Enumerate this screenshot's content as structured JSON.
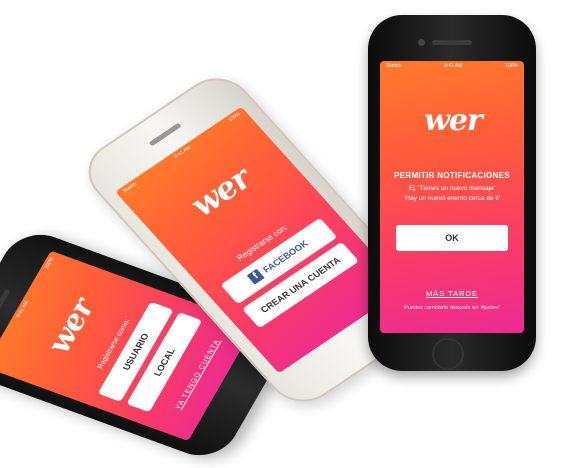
{
  "statusbar": {
    "carrier": "Sketch",
    "time": "9:41 AM",
    "battery": "100%"
  },
  "logo": "wer",
  "phone1": {
    "prompt": "Registrarse como:",
    "user_button": "USUARIO",
    "local_button": "LOCAL",
    "link": "YA TENGO CUENTA"
  },
  "phone2": {
    "prompt": "Registrarse con:",
    "facebook_button": "FACEBOOK",
    "facebook_icon_glyph": "f",
    "create_button": "CREAR UNA CUENTA"
  },
  "phone3": {
    "title": "PERMITIR NOTIFICACIONES",
    "example_line1": "Ej. 'Tienes un nuevo mensaje'",
    "example_line2": "'Hay un nuevo evento cerca de ti'",
    "ok_button": "OK",
    "later_link": "MÁS TARDE",
    "footnote": "Puedes cambiarlo después en 'Ajustes'"
  },
  "colors": {
    "gradient_top": "#ff7a2a",
    "gradient_bottom": "#ec2a93",
    "facebook": "#3b5998"
  }
}
